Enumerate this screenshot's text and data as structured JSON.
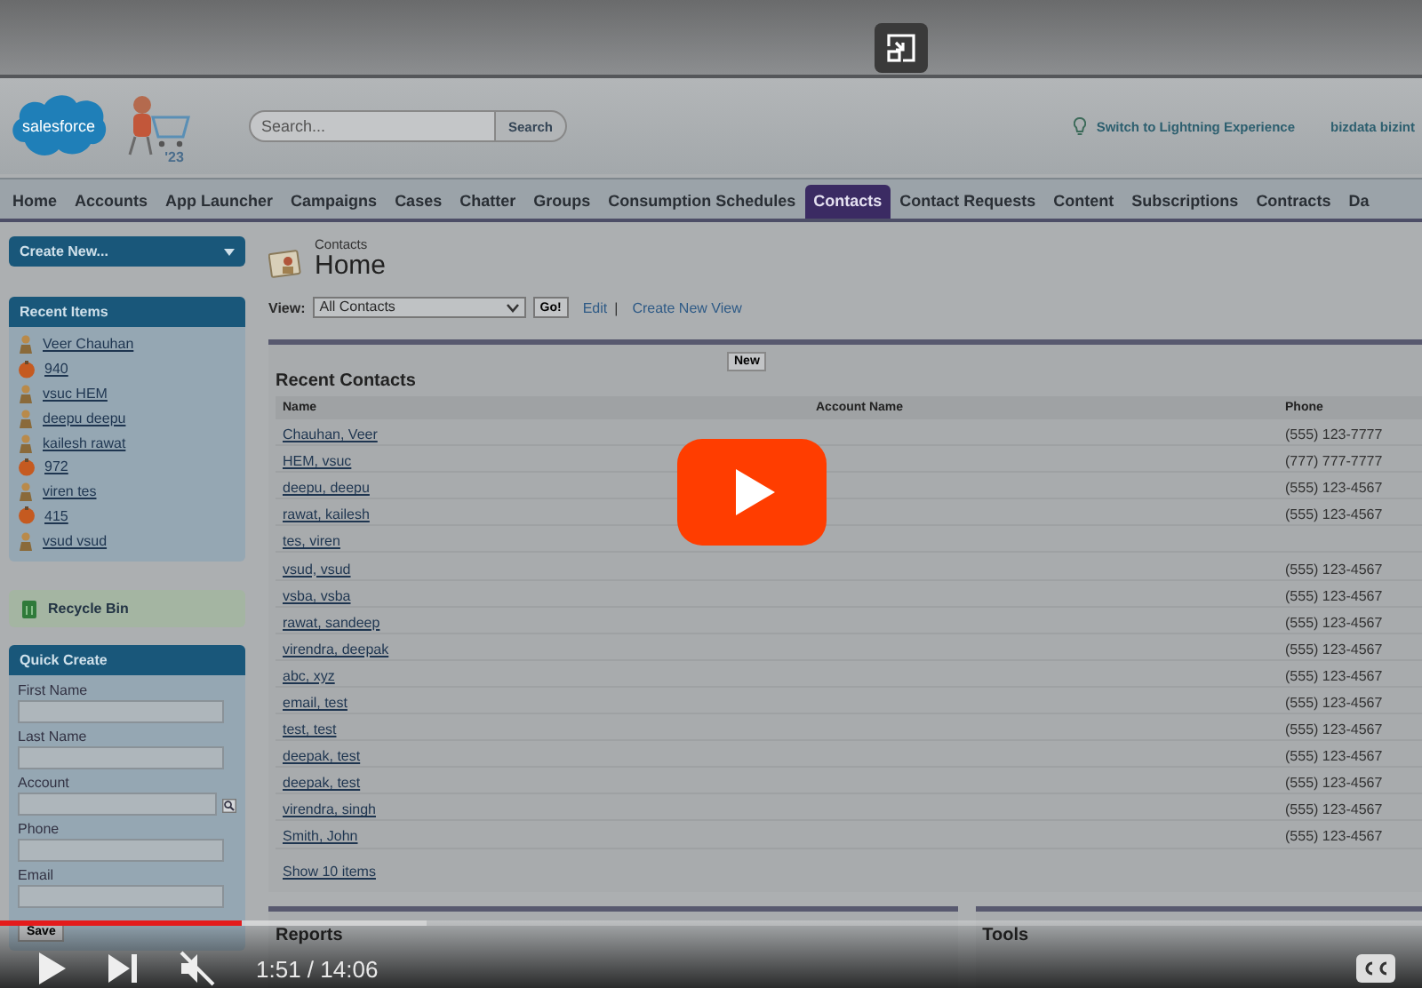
{
  "player": {
    "muted": true,
    "time": "1:51 / 14:06",
    "progress": {
      "level": 0.17
    },
    "buffered": {
      "level": 0.3
    }
  },
  "header": {
    "logo_text": "salesforce",
    "mascot_badge": "'23",
    "search_placeholder": "Search...",
    "search_button": "Search",
    "lightning_link": "Switch to Lightning Experience",
    "user": "bizdata bizint"
  },
  "tabs": [
    {
      "label": "Home",
      "selected": false
    },
    {
      "label": "Accounts",
      "selected": false
    },
    {
      "label": "App Launcher",
      "selected": false
    },
    {
      "label": "Campaigns",
      "selected": false
    },
    {
      "label": "Cases",
      "selected": false
    },
    {
      "label": "Chatter",
      "selected": false
    },
    {
      "label": "Groups",
      "selected": false
    },
    {
      "label": "Consumption Schedules",
      "selected": false
    },
    {
      "label": "Contacts",
      "selected": true
    },
    {
      "label": "Contact Requests",
      "selected": false
    },
    {
      "label": "Content",
      "selected": false
    },
    {
      "label": "Subscriptions",
      "selected": false
    },
    {
      "label": "Contracts",
      "selected": false
    },
    {
      "label": "Da",
      "selected": false
    }
  ],
  "sidebar": {
    "create_new": "Create New...",
    "recent_items": {
      "title": "Recent Items",
      "items": [
        {
          "name": "Veer Chauhan",
          "kind": "contact"
        },
        {
          "name": "940",
          "kind": "case"
        },
        {
          "name": "vsuc HEM",
          "kind": "contact"
        },
        {
          "name": "deepu deepu",
          "kind": "contact"
        },
        {
          "name": "kailesh rawat",
          "kind": "contact"
        },
        {
          "name": "972",
          "kind": "case"
        },
        {
          "name": "viren tes",
          "kind": "contact"
        },
        {
          "name": "415",
          "kind": "case"
        },
        {
          "name": "vsud vsud",
          "kind": "contact"
        }
      ]
    },
    "recycle_bin": "Recycle Bin",
    "quick_create": {
      "title": "Quick Create",
      "fields": [
        {
          "label": "First Name",
          "kind": "text"
        },
        {
          "label": "Last Name",
          "kind": "text"
        },
        {
          "label": "Account",
          "kind": "lookup"
        },
        {
          "label": "Phone",
          "kind": "text"
        },
        {
          "label": "Email",
          "kind": "text"
        }
      ],
      "save": "Save"
    }
  },
  "main": {
    "breadcrumb": "Contacts",
    "title": "Home",
    "view": {
      "label": "View:",
      "selected": "All Contacts",
      "go": "Go!",
      "edit": "Edit",
      "separator": "|",
      "create": "Create New View"
    },
    "recent_contacts": {
      "title": "Recent Contacts",
      "new_button": "New",
      "columns": [
        "Name",
        "Account Name",
        "Phone"
      ],
      "rows": [
        {
          "name": "Chauhan, Veer",
          "phone": "(555) 123-7777"
        },
        {
          "name": "HEM, vsuc",
          "phone": "(777) 777-7777"
        },
        {
          "name": "deepu, deepu",
          "phone": "(555) 123-4567"
        },
        {
          "name": "rawat, kailesh",
          "phone": "(555) 123-4567"
        },
        {
          "name": "tes, viren"
        },
        {
          "name": "vsud, vsud",
          "phone": "(555) 123-4567"
        },
        {
          "name": "vsba, vsba",
          "phone": "(555) 123-4567"
        },
        {
          "name": "rawat, sandeep",
          "phone": "(555) 123-4567"
        },
        {
          "name": "virendra, deepak",
          "phone": "(555) 123-4567"
        },
        {
          "name": "abc, xyz",
          "phone": "(555) 123-4567"
        },
        {
          "name": "email, test",
          "phone": "(555) 123-4567"
        },
        {
          "name": "test, test",
          "phone": "(555) 123-4567"
        },
        {
          "name": "deepak, test",
          "phone": "(555) 123-4567"
        },
        {
          "name": "deepak, test",
          "phone": "(555) 123-4567"
        },
        {
          "name": "virendra, singh",
          "phone": "(555) 123-4567"
        },
        {
          "name": "Smith, John",
          "phone": "(555) 123-4567"
        }
      ],
      "show_more": "Show 10 items"
    },
    "reports_title": "Reports",
    "tools_title": "Tools"
  }
}
